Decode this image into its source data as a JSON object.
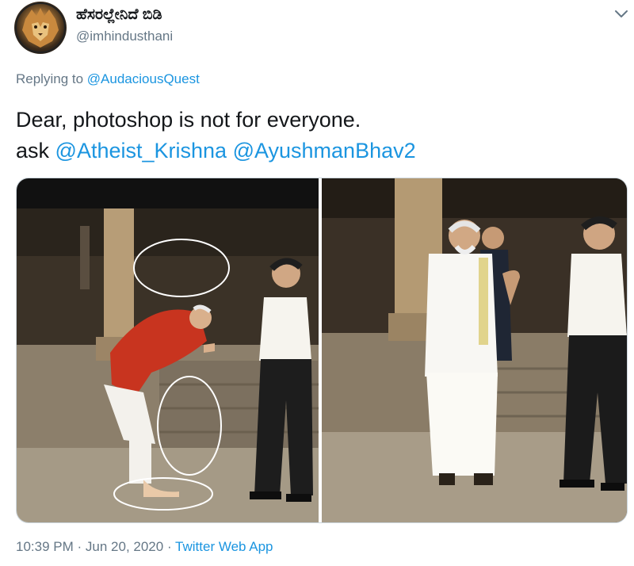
{
  "tweet": {
    "display_name": "ಹೆಸರಲ್ಲೇನಿದೆ ಬಿಡಿ",
    "handle": "@imhindusthani",
    "avatar_icon": "lion-avatar",
    "menu_icon": "chevron-down-icon",
    "replying_prefix": "Replying to",
    "replying_to": "@AudaciousQuest",
    "text_line1": "Dear, photoshop is not for everyone.",
    "text_line2_prefix": "ask",
    "mention1": "@Atheist_Krishna",
    "mention2": "@AyushmanBhav2",
    "time": "10:39 PM",
    "separator1": "·",
    "date": "Jun 20, 2020",
    "separator2": "·",
    "source": "Twitter Web App"
  },
  "colors": {
    "link": "#1b95e0",
    "muted": "#657786",
    "text": "#14171a",
    "border": "#ccd6dd"
  }
}
